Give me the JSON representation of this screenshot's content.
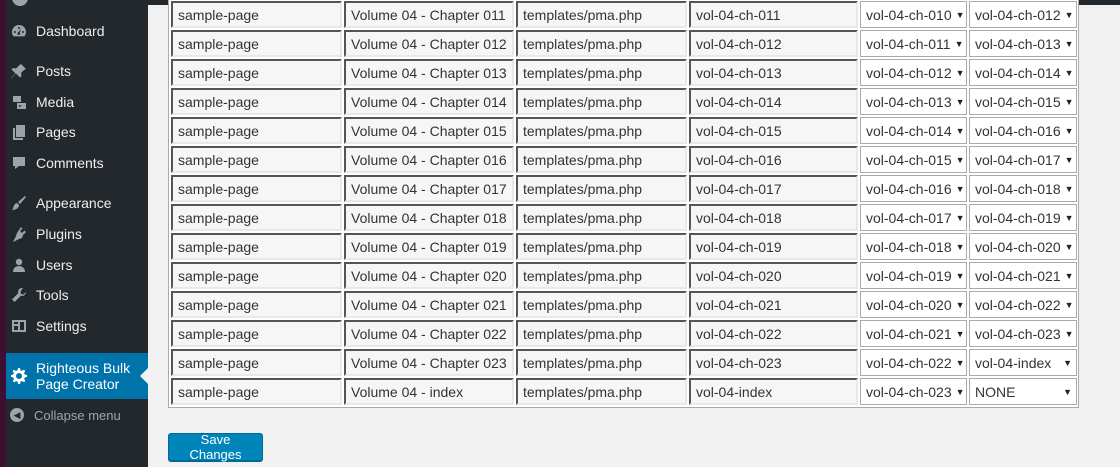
{
  "sidebar": {
    "items": [
      {
        "label": "Dashboard",
        "icon": "dashboard-icon"
      },
      {
        "label": "Posts",
        "icon": "pin-icon"
      },
      {
        "label": "Media",
        "icon": "media-icon"
      },
      {
        "label": "Pages",
        "icon": "pages-icon"
      },
      {
        "label": "Comments",
        "icon": "comment-icon"
      },
      {
        "label": "Appearance",
        "icon": "paintbrush-icon"
      },
      {
        "label": "Plugins",
        "icon": "plugin-icon"
      },
      {
        "label": "Users",
        "icon": "user-icon"
      },
      {
        "label": "Tools",
        "icon": "wrench-icon"
      },
      {
        "label": "Settings",
        "icon": "settings-icon"
      },
      {
        "label": "Righteous Bulk Page Creator",
        "icon": "gear-icon",
        "current": true
      }
    ],
    "collapse_label": "Collapse menu"
  },
  "table": {
    "rows": [
      [
        "sample-page",
        "Volume 04 - Chapter 011",
        "templates/pma.php",
        "vol-04-ch-011",
        "vol-04-ch-010",
        "vol-04-ch-012"
      ],
      [
        "sample-page",
        "Volume 04 - Chapter 012",
        "templates/pma.php",
        "vol-04-ch-012",
        "vol-04-ch-011",
        "vol-04-ch-013"
      ],
      [
        "sample-page",
        "Volume 04 - Chapter 013",
        "templates/pma.php",
        "vol-04-ch-013",
        "vol-04-ch-012",
        "vol-04-ch-014"
      ],
      [
        "sample-page",
        "Volume 04 - Chapter 014",
        "templates/pma.php",
        "vol-04-ch-014",
        "vol-04-ch-013",
        "vol-04-ch-015"
      ],
      [
        "sample-page",
        "Volume 04 - Chapter 015",
        "templates/pma.php",
        "vol-04-ch-015",
        "vol-04-ch-014",
        "vol-04-ch-016"
      ],
      [
        "sample-page",
        "Volume 04 - Chapter 016",
        "templates/pma.php",
        "vol-04-ch-016",
        "vol-04-ch-015",
        "vol-04-ch-017"
      ],
      [
        "sample-page",
        "Volume 04 - Chapter 017",
        "templates/pma.php",
        "vol-04-ch-017",
        "vol-04-ch-016",
        "vol-04-ch-018"
      ],
      [
        "sample-page",
        "Volume 04 - Chapter 018",
        "templates/pma.php",
        "vol-04-ch-018",
        "vol-04-ch-017",
        "vol-04-ch-019"
      ],
      [
        "sample-page",
        "Volume 04 - Chapter 019",
        "templates/pma.php",
        "vol-04-ch-019",
        "vol-04-ch-018",
        "vol-04-ch-020"
      ],
      [
        "sample-page",
        "Volume 04 - Chapter 020",
        "templates/pma.php",
        "vol-04-ch-020",
        "vol-04-ch-019",
        "vol-04-ch-021"
      ],
      [
        "sample-page",
        "Volume 04 - Chapter 021",
        "templates/pma.php",
        "vol-04-ch-021",
        "vol-04-ch-020",
        "vol-04-ch-022"
      ],
      [
        "sample-page",
        "Volume 04 - Chapter 022",
        "templates/pma.php",
        "vol-04-ch-022",
        "vol-04-ch-021",
        "vol-04-ch-023"
      ],
      [
        "sample-page",
        "Volume 04 - Chapter 023",
        "templates/pma.php",
        "vol-04-ch-023",
        "vol-04-ch-022",
        "vol-04-index"
      ],
      [
        "sample-page",
        "Volume 04 - index",
        "templates/pma.php",
        "vol-04-index",
        "vol-04-ch-023",
        "NONE"
      ]
    ]
  },
  "save_button_label": "Save Changes",
  "colors": {
    "sidebar_bg": "#23282d",
    "current_item_bg": "#0073aa",
    "button_bg": "#0085ba",
    "page_bg": "#f1f1f1"
  }
}
